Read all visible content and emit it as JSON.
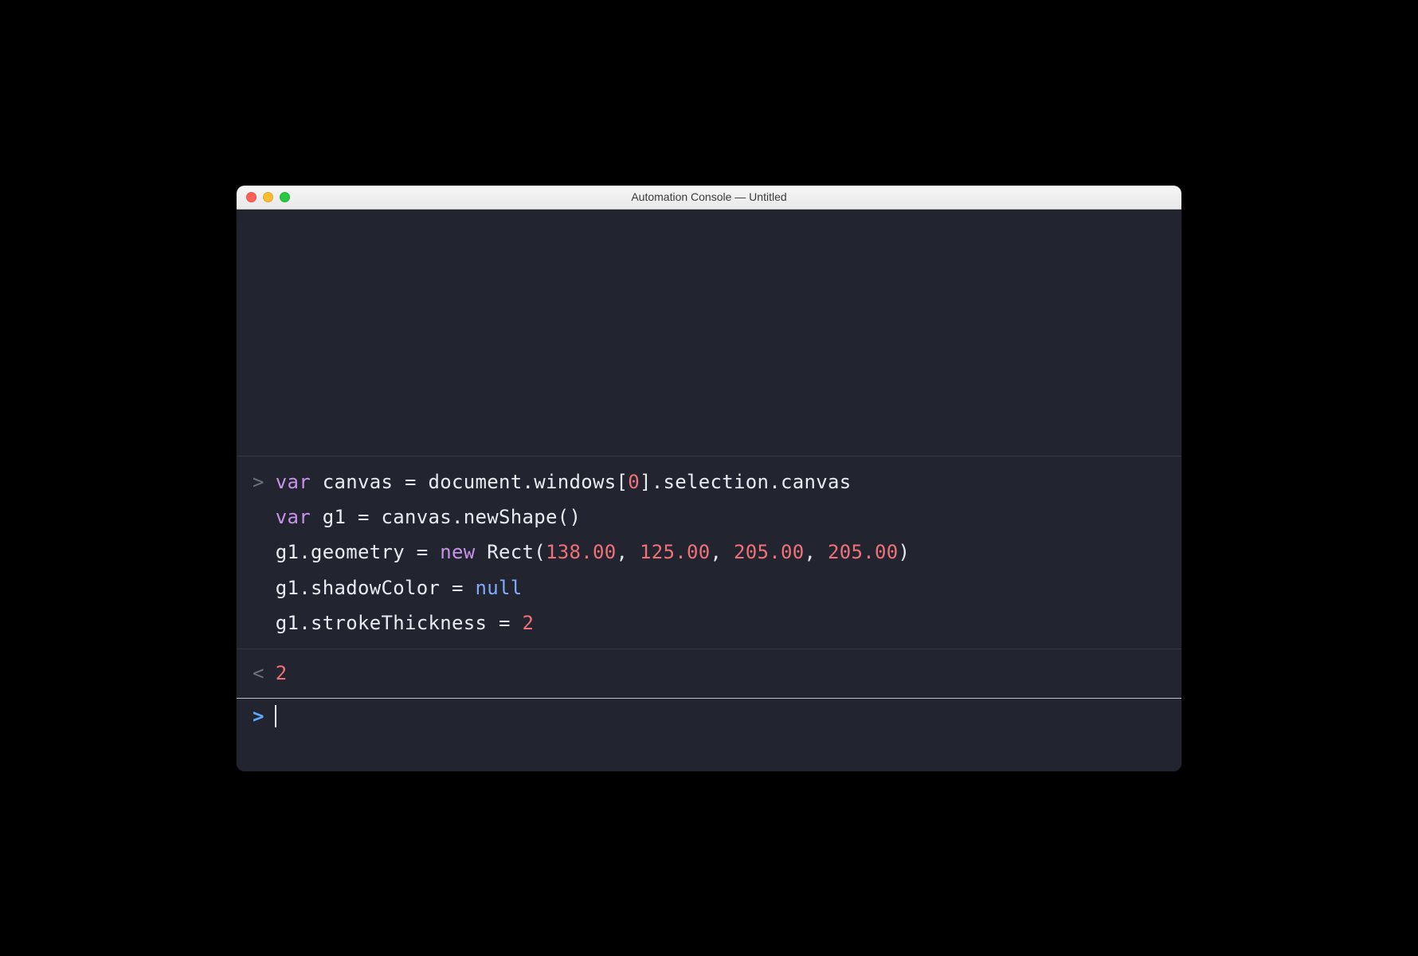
{
  "window": {
    "title": "Automation Console — Untitled"
  },
  "console": {
    "input_prompt_marker": ">",
    "result_marker": "<",
    "entry_prompt": ">",
    "lines": {
      "l1": {
        "var": "var",
        "id": "canvas",
        "eq": " = ",
        "rest": "document.windows[",
        "idx": "0",
        "rest2": "].selection.canvas"
      },
      "l2": {
        "var": "var",
        "id": "g1",
        "eq": " = ",
        "rest": "canvas.newShape()"
      },
      "l3": {
        "lhs": "g1.geometry = ",
        "new": "new",
        "cls": " Rect(",
        "n1": "138.00",
        "c1": ", ",
        "n2": "125.00",
        "c2": ", ",
        "n3": "205.00",
        "c3": ", ",
        "n4": "205.00",
        "close": ")"
      },
      "l4": {
        "lhs": "g1.shadowColor = ",
        "null": "null"
      },
      "l5": {
        "lhs": "g1.strokeThickness = ",
        "num": "2"
      }
    },
    "result": {
      "value": "2"
    }
  }
}
